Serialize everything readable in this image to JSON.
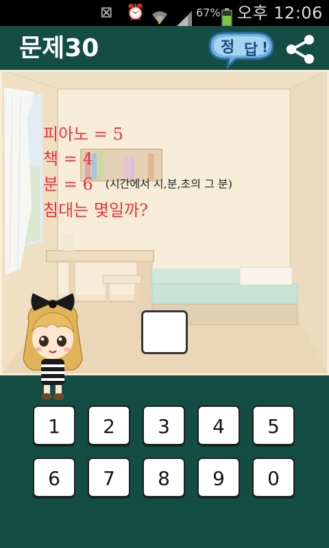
{
  "status_bar": {
    "battery_percent": "67%",
    "clock": "오후 12:06",
    "icons": [
      "mute-icon",
      "alarm-icon",
      "wifi-icon",
      "signal-icon",
      "battery-icon"
    ]
  },
  "header": {
    "title": "문제30",
    "answer_button": {
      "char1": "정",
      "char2": "답",
      "mark": "!"
    },
    "share_icon": "share-icon"
  },
  "puzzle": {
    "line1": "피아노 = 5",
    "line2": "책 = 4",
    "line3": "분 = 6",
    "hint": "(시간에서 시,분,초의 그 분)",
    "question": "침대는 몇일까?",
    "answer_value": ""
  },
  "keypad": {
    "keys": [
      "1",
      "2",
      "3",
      "4",
      "5",
      "6",
      "7",
      "8",
      "9",
      "0"
    ]
  },
  "colors": {
    "header_bg": "#134d44",
    "puzzle_text": "#e8333e",
    "hint_text": "#222222"
  }
}
